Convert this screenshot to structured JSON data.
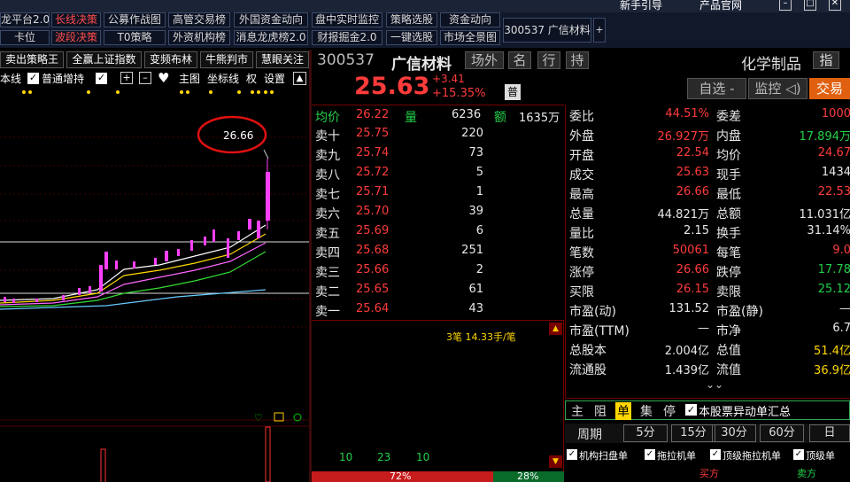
{
  "topbar": {
    "xinshou": "新手引导",
    "product": "产品官网"
  },
  "toolbar": {
    "row1": [
      "龙平台2.0",
      "长线决策",
      "公募作战图",
      "高管交易榜",
      "外国资金动向",
      "盘中实时监控",
      "策略选股",
      "资金动向"
    ],
    "row2": [
      "卡位",
      "波段决策",
      "T0策略",
      "外资机构榜",
      "消息龙虎榜2.0",
      "财报掘金2.0",
      "一键选股",
      "市场全景图"
    ],
    "stock_button": "300537 广信材料",
    "plus": "+"
  },
  "left_tabs": [
    "卖出策略王",
    "全赢上证指数",
    "变频布林",
    "牛熊判市",
    "慧眼关注"
  ],
  "chart_toolbar": {
    "benxian": "本线",
    "putong": "普通增持",
    "zhutu": "主图",
    "zuobiao": "坐标线",
    "quan": "权",
    "shezhi": "设置"
  },
  "chart": {
    "max_label": "26.66"
  },
  "header": {
    "code": "300537",
    "name": "广信材料",
    "tags": [
      "场外",
      "名",
      "行",
      "持"
    ],
    "price": "25.63",
    "change": "+3.41",
    "change_pct": "+15.35%",
    "pu": "普",
    "industry": "化学制品",
    "zhi": "指",
    "btn_zixuan": "自选 -",
    "btn_jiankong": "监控 ◁)",
    "btn_jiaoyi": "交易"
  },
  "avg_row": {
    "label": "均价",
    "price": "26.22",
    "liang_label": "量",
    "volume": "6236",
    "e_label": "额",
    "amount": "1635万"
  },
  "asks": [
    {
      "label": "卖十",
      "price": "25.75",
      "vol": "220"
    },
    {
      "label": "卖九",
      "price": "25.74",
      "vol": "73"
    },
    {
      "label": "卖八",
      "price": "25.72",
      "vol": "5"
    },
    {
      "label": "卖七",
      "price": "25.71",
      "vol": "1"
    },
    {
      "label": "卖六",
      "price": "25.70",
      "vol": "39"
    },
    {
      "label": "卖五",
      "price": "25.69",
      "vol": "6"
    },
    {
      "label": "卖四",
      "price": "25.68",
      "vol": "251"
    },
    {
      "label": "卖三",
      "price": "25.66",
      "vol": "2"
    },
    {
      "label": "卖二",
      "price": "25.65",
      "vol": "61"
    },
    {
      "label": "卖一",
      "price": "25.64",
      "vol": "43"
    }
  ],
  "ticks": {
    "summary": "3笔 14.33手/笔",
    "n1": "10",
    "n2": "23",
    "n3": "10",
    "buy_pct": "72%",
    "sell_pct": "28%"
  },
  "stats": [
    {
      "l": "委比",
      "lv": "44.51%",
      "lc": "red",
      "r": "委差",
      "rv": "1000",
      "rc": "red"
    },
    {
      "l": "外盘",
      "lv": "26.927万",
      "lc": "red",
      "r": "内盘",
      "rv": "17.894万",
      "rc": "green"
    },
    {
      "l": "开盘",
      "lv": "22.54",
      "lc": "red",
      "r": "均价",
      "rv": "24.67",
      "rc": "red"
    },
    {
      "l": "成交",
      "lv": "25.63",
      "lc": "red",
      "r": "现手",
      "rv": "1434",
      "rc": "white"
    },
    {
      "l": "最高",
      "lv": "26.66",
      "lc": "red",
      "r": "最低",
      "rv": "22.53",
      "rc": "red"
    },
    {
      "l": "总量",
      "lv": "44.821万",
      "lc": "white",
      "r": "总额",
      "rv": "11.031亿",
      "rc": "white"
    },
    {
      "l": "量比",
      "lv": "2.15",
      "lc": "white",
      "r": "换手",
      "rv": "31.14%",
      "rc": "white"
    },
    {
      "l": "笔数",
      "lv": "50061",
      "lc": "red",
      "r": "每笔",
      "rv": "9.0",
      "rc": "red"
    },
    {
      "l": "涨停",
      "lv": "26.66",
      "lc": "red",
      "r": "跌停",
      "rv": "17.78",
      "rc": "green"
    },
    {
      "l": "买限",
      "lv": "26.15",
      "lc": "red",
      "r": "卖限",
      "rv": "25.12",
      "rc": "green"
    },
    {
      "l": "市盈(动)",
      "lv": "131.52",
      "lc": "white",
      "r": "市盈(静)",
      "rv": "—",
      "rc": "white"
    },
    {
      "l": "市盈(TTM)",
      "lv": "—",
      "lc": "white",
      "r": "市净",
      "rv": "6.7",
      "rc": "white"
    },
    {
      "l": "总股本",
      "lv": "2.004亿",
      "lc": "white",
      "r": "总值",
      "rv": "51.4亿",
      "rc": "yel"
    },
    {
      "l": "流通股",
      "lv": "1.439亿",
      "lc": "white",
      "r": "流值",
      "rv": "36.9亿",
      "rc": "yel"
    }
  ],
  "drag": {
    "tabs": [
      "主",
      "阻",
      "单",
      "集",
      "停"
    ],
    "notice": "本股票异动单汇总",
    "period_label": "周期",
    "periods": [
      "5分",
      "15分",
      "30分",
      "60分",
      "日"
    ],
    "checks": [
      "机构扫盘单",
      "拖拉机单",
      "顶级拖拉机单",
      "顶级单"
    ],
    "buy": "买方",
    "sell": "卖方"
  }
}
